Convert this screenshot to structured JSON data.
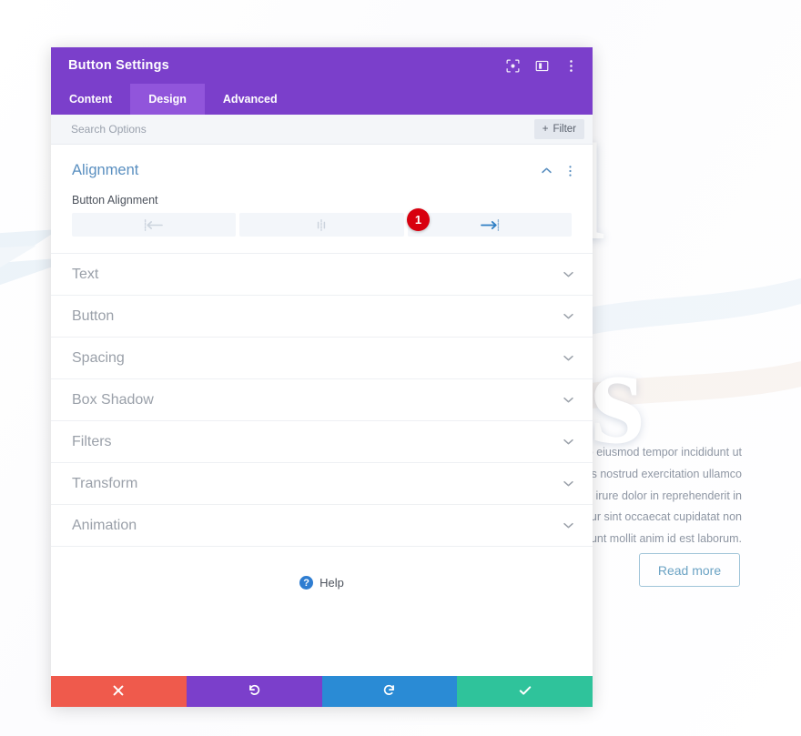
{
  "background": {
    "heading_line1": "ul",
    "heading_line2": "ws",
    "paragraph_lines": [
      "do eiusmod tempor incididunt ut",
      "quis nostrud exercitation ullamco",
      "te irure dolor in reprehenderit in",
      "pteur sint occaecat cupidatat non",
      "erunt mollit anim id est laborum."
    ],
    "read_more_label": "Read more"
  },
  "modal": {
    "title": "Button Settings",
    "titlebar_icons": [
      {
        "name": "focus-icon",
        "label": "Focus"
      },
      {
        "name": "layout-icon",
        "label": "Layout"
      },
      {
        "name": "more-options-icon",
        "label": "More Options"
      }
    ],
    "tabs": [
      {
        "label": "Content",
        "active": false
      },
      {
        "label": "Design",
        "active": true
      },
      {
        "label": "Advanced",
        "active": false
      }
    ],
    "search": {
      "value": "",
      "placeholder": "Search Options"
    },
    "filter_button": {
      "label": "Filter",
      "plus": "+"
    },
    "open_section": {
      "title": "Alignment",
      "collapse_icon": "chevron-up",
      "menu_icon": "kebab",
      "field_label": "Button Alignment",
      "options": [
        {
          "name": "align-left",
          "active": false
        },
        {
          "name": "align-center",
          "active": false
        },
        {
          "name": "align-right",
          "active": true
        }
      ],
      "badge": "1"
    },
    "sections": [
      {
        "label": "Text"
      },
      {
        "label": "Button"
      },
      {
        "label": "Spacing"
      },
      {
        "label": "Box Shadow"
      },
      {
        "label": "Filters"
      },
      {
        "label": "Transform"
      },
      {
        "label": "Animation"
      }
    ],
    "help": {
      "label": "Help",
      "icon_glyph": "?"
    },
    "footer_buttons": [
      {
        "name": "cancel-button",
        "icon": "close-icon",
        "color": "#ef5a4c"
      },
      {
        "name": "undo-button",
        "icon": "undo-icon",
        "color": "#7B3FCB"
      },
      {
        "name": "redo-button",
        "icon": "redo-icon",
        "color": "#2a8bd5"
      },
      {
        "name": "save-button",
        "icon": "checkmark-icon",
        "color": "#2fc39b"
      }
    ]
  },
  "colors": {
    "brand_purple": "#7B3FCB",
    "tab_active_purple": "#9155DB",
    "accent_blue": "#5a8fc0",
    "badge_red": "#d8000f",
    "save_green": "#2fc39b"
  }
}
